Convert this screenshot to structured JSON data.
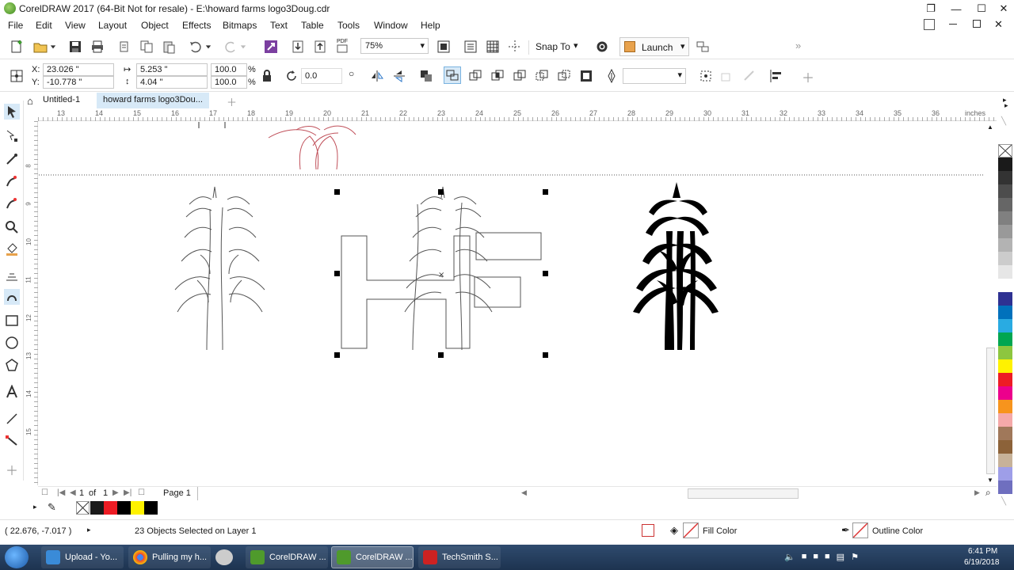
{
  "window": {
    "title": "CorelDRAW 2017 (64-Bit Not for resale) - E:\\howard farms logo3Doug.cdr"
  },
  "menu": [
    "File",
    "Edit",
    "View",
    "Layout",
    "Object",
    "Effects",
    "Bitmaps",
    "Text",
    "Table",
    "Tools",
    "Window",
    "Help"
  ],
  "toolbar": {
    "zoom": "75%",
    "snap_label": "Snap To",
    "launch_label": "Launch",
    "pdf_label": "PDF"
  },
  "property_bar": {
    "x_label": "X:",
    "x_value": "23.026 \"",
    "y_label": "Y:",
    "y_value": "-10.778 \"",
    "width_value": "5.253 \"",
    "height_value": "4.04 \"",
    "scale_x": "100.0",
    "scale_y": "100.0",
    "percent": "%",
    "rotation": "0.0"
  },
  "tabs": [
    {
      "label": "Untitled-1"
    },
    {
      "label": "howard farms logo3Dou..."
    }
  ],
  "ruler": {
    "h_ticks": [
      "13",
      "14",
      "15",
      "16",
      "17",
      "18",
      "19",
      "20",
      "21",
      "22",
      "23",
      "24",
      "25",
      "26",
      "27",
      "28",
      "29",
      "30",
      "31",
      "32",
      "33",
      "34",
      "35",
      "36"
    ],
    "unit": "inches",
    "v_ticks": [
      "8",
      "9",
      "10",
      "11",
      "12",
      "13",
      "14",
      "15"
    ]
  },
  "page_nav": {
    "current": "1",
    "of": "of",
    "total": "1",
    "page_tab": "Page 1"
  },
  "palette_colors": [
    "#1a1a1a",
    "#333333",
    "#4d4d4d",
    "#666666",
    "#808080",
    "#999999",
    "#b3b3b3",
    "#cccccc",
    "#e6e6e6",
    "#ffffff",
    "#2e3192",
    "#0071bc",
    "#29abe2",
    "#00a651",
    "#8dc63f",
    "#fff200",
    "#ed1c24",
    "#ec008c",
    "#f7941d",
    "#f5a9a9",
    "#a0785a",
    "#8c6239",
    "#c7b299",
    "#9e9ee8",
    "#6f6fbf"
  ],
  "doc_palette": [
    "#ffffff",
    "#1a1a1a",
    "#ed1c24",
    "#000000",
    "#fff200",
    "#000000"
  ],
  "status": {
    "cursor": "( 22.676, -7.017 )",
    "selection": "23 Objects Selected on Layer 1",
    "fill_label": "Fill Color",
    "outline_label": "Outline Color"
  },
  "taskbar": {
    "items": [
      "Upload - Yo...",
      "Pulling my h...",
      "CorelDRAW ...",
      "CorelDRAW ...",
      "TechSmith S..."
    ],
    "time": "6:41 PM",
    "date": "6/19/2018"
  }
}
